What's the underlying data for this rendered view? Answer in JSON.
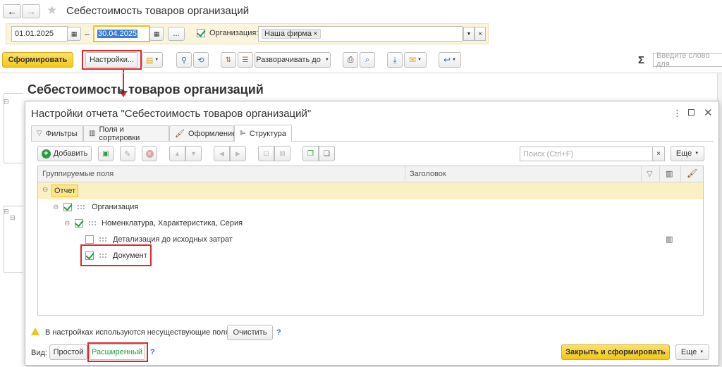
{
  "window": {
    "title": "Себестоимость товаров организаций"
  },
  "period": {
    "date_from": "01.01.2025",
    "dash": "–",
    "date_to": "30.04.2025",
    "ellipsis": "...",
    "org_label": "Организация:",
    "org_value": "Наша фирма"
  },
  "toolbar": {
    "generate": "Сформировать",
    "settings": "Настройки...",
    "expand_to": "Разворачивать до",
    "sigma": "Σ",
    "search_placeholder": "Введите слово для"
  },
  "report": {
    "title": "Себестоимость товаров организаций"
  },
  "dialog": {
    "title": "Настройки отчета \"Себестоимость товаров организаций\"",
    "tabs": [
      {
        "label": "Фильтры"
      },
      {
        "label": "Поля и сортировки"
      },
      {
        "label": "Оформление"
      },
      {
        "label": "Структура"
      }
    ],
    "add_button": "Добавить",
    "search_placeholder": "Поиск (Ctrl+F)",
    "more": "Еще",
    "columns": {
      "group_fields": "Группируемые поля",
      "heading": "Заголовок"
    },
    "tree": [
      {
        "label": "Отчет"
      },
      {
        "label": "Организация"
      },
      {
        "label": "Номенклатура, Характеристика, Серия"
      },
      {
        "label": "Детализация до исходных затрат"
      },
      {
        "label": "Документ"
      }
    ],
    "warning": "В настройках используются несуществующие поля.",
    "clear": "Очистить",
    "help": "?",
    "view_label": "Вид:",
    "view_simple": "Простой",
    "view_extended": "Расширенный",
    "close_generate": "Закрыть и сформировать",
    "more_bottom": "Еще"
  },
  "colors": {
    "accent_yellow": "#f7d033",
    "highlight_row": "#fbefc4",
    "callout_red": "#e3262c",
    "check_green": "#1e9e46"
  }
}
